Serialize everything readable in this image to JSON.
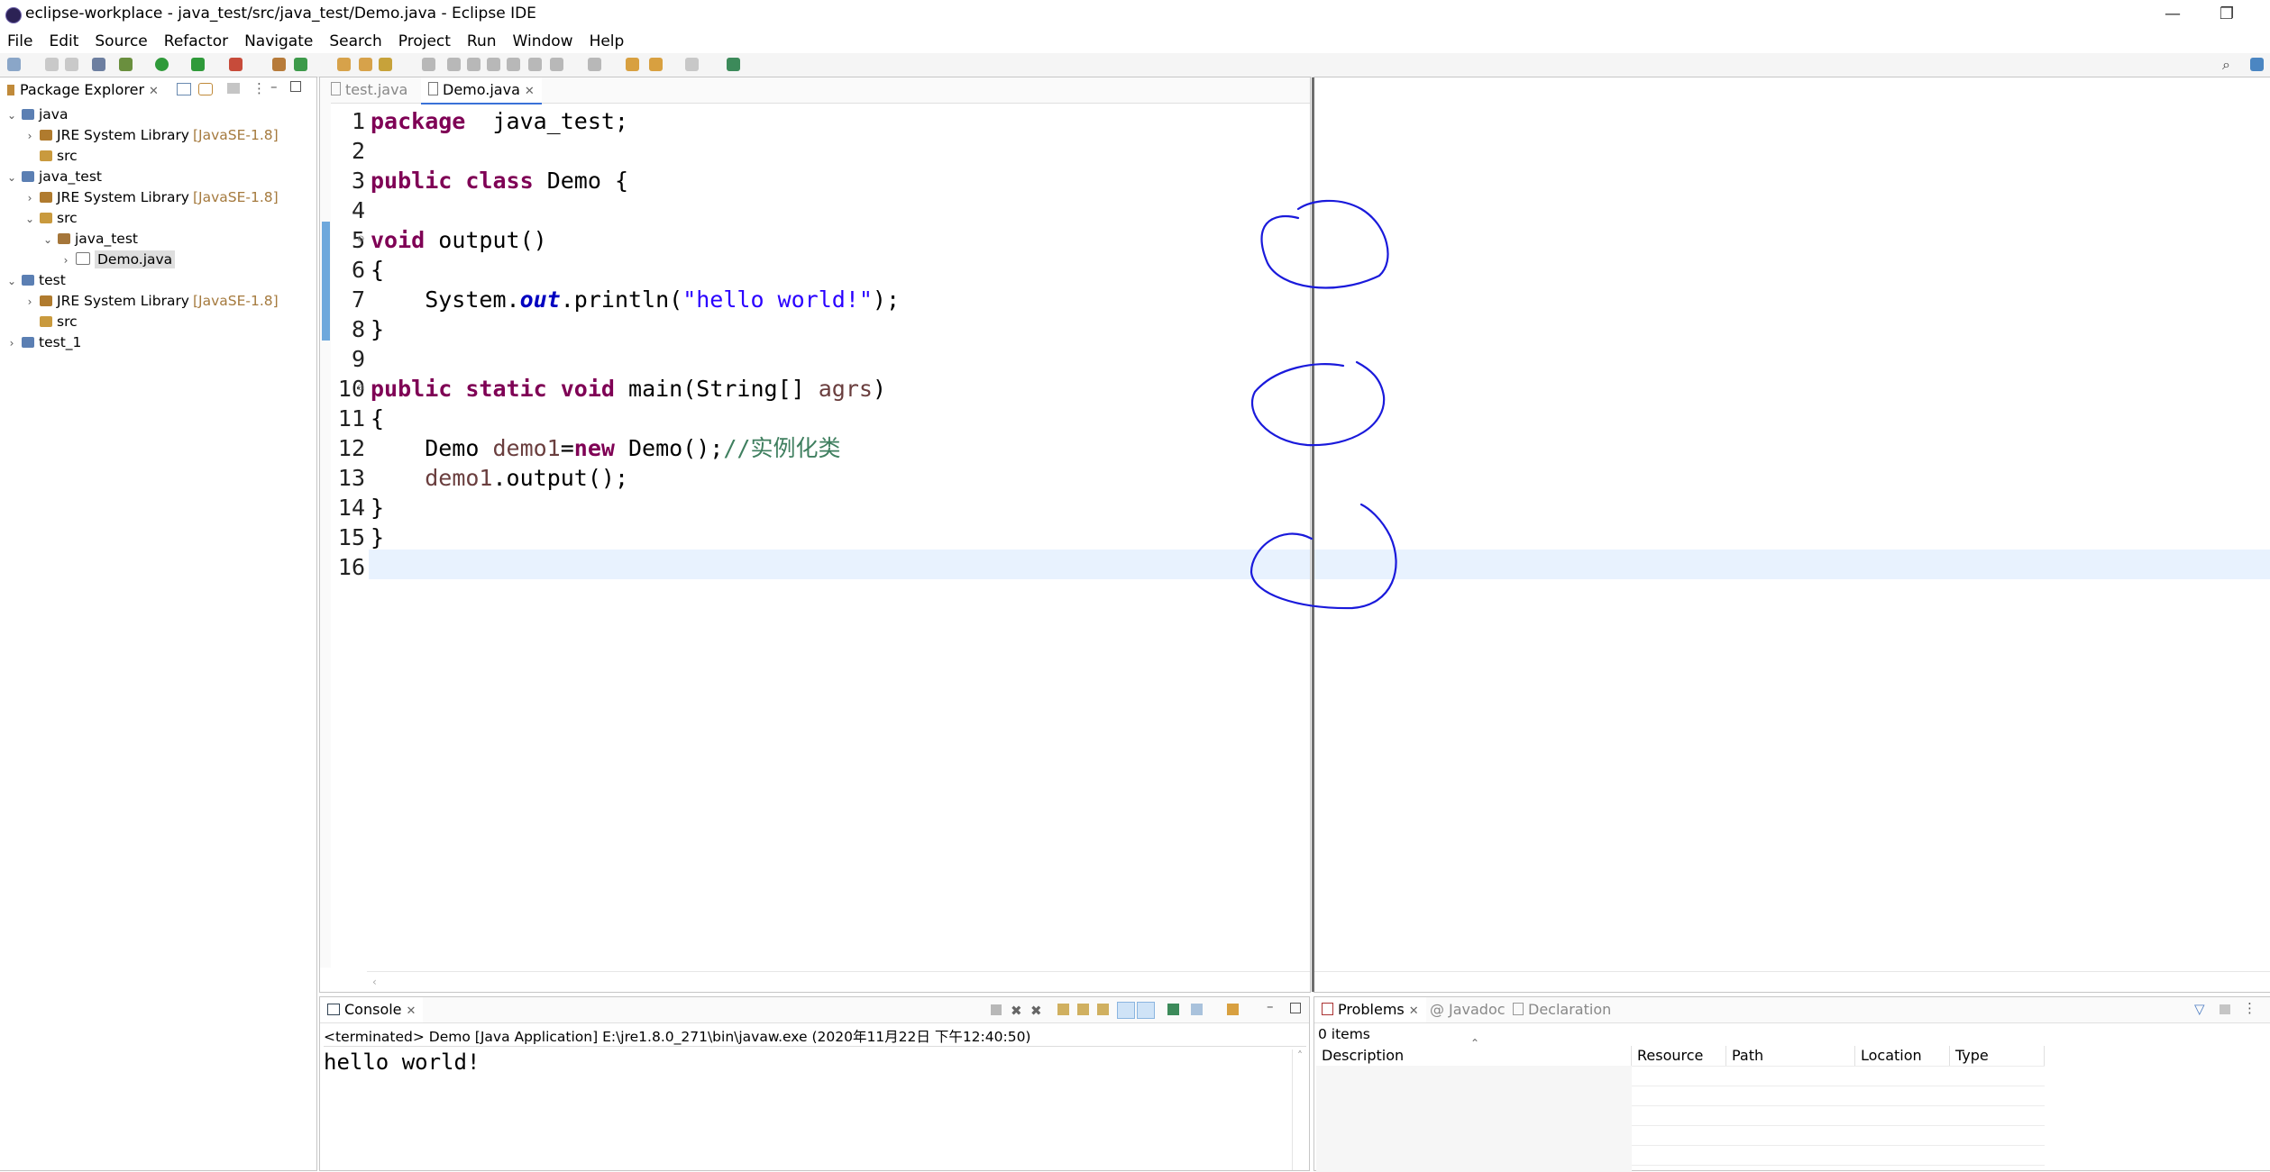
{
  "window": {
    "title": "eclipse-workplace - java_test/src/java_test/Demo.java - Eclipse IDE",
    "minimize_glyph": "—",
    "restore_glyph": "❐"
  },
  "menu": [
    "File",
    "Edit",
    "Source",
    "Refactor",
    "Navigate",
    "Search",
    "Project",
    "Run",
    "Window",
    "Help"
  ],
  "package_explorer": {
    "tab_label": "Package Explorer",
    "tree": [
      {
        "indent": 0,
        "arrow": "⌄",
        "icon": "project",
        "label": "java",
        "decoration": ""
      },
      {
        "indent": 1,
        "arrow": "›",
        "icon": "library",
        "label": "JRE System Library",
        "decoration": "[JavaSE-1.8]"
      },
      {
        "indent": 1,
        "arrow": "",
        "icon": "src",
        "label": "src",
        "decoration": ""
      },
      {
        "indent": 0,
        "arrow": "⌄",
        "icon": "project",
        "label": "java_test",
        "decoration": ""
      },
      {
        "indent": 1,
        "arrow": "›",
        "icon": "library",
        "label": "JRE System Library",
        "decoration": "[JavaSE-1.8]"
      },
      {
        "indent": 1,
        "arrow": "⌄",
        "icon": "src",
        "label": "src",
        "decoration": ""
      },
      {
        "indent": 2,
        "arrow": "⌄",
        "icon": "package",
        "label": "java_test",
        "decoration": ""
      },
      {
        "indent": 3,
        "arrow": "›",
        "icon": "java-file",
        "label": "Demo.java",
        "decoration": "",
        "selected": true
      },
      {
        "indent": 0,
        "arrow": "⌄",
        "icon": "project",
        "label": "test",
        "decoration": ""
      },
      {
        "indent": 1,
        "arrow": "›",
        "icon": "library",
        "label": "JRE System Library",
        "decoration": "[JavaSE-1.8]"
      },
      {
        "indent": 1,
        "arrow": "",
        "icon": "src",
        "label": "src",
        "decoration": ""
      },
      {
        "indent": 0,
        "arrow": "›",
        "icon": "project",
        "label": "test_1",
        "decoration": ""
      }
    ]
  },
  "editor": {
    "tabs": [
      {
        "label": "test.java",
        "active": false
      },
      {
        "label": "Demo.java",
        "active": true
      }
    ],
    "fold_marker_lines": [
      5,
      10
    ],
    "current_line": 16,
    "lines": [
      {
        "n": "1",
        "tokens": [
          [
            "kw",
            "package"
          ],
          [
            "",
            "  java_test;"
          ]
        ]
      },
      {
        "n": "2",
        "tokens": []
      },
      {
        "n": "3",
        "tokens": [
          [
            "kw",
            "public"
          ],
          [
            "",
            " "
          ],
          [
            "kw",
            "class"
          ],
          [
            "",
            " Demo {"
          ]
        ]
      },
      {
        "n": "4",
        "tokens": []
      },
      {
        "n": "5",
        "tokens": [
          [
            "kw",
            "void"
          ],
          [
            "",
            " output()"
          ]
        ]
      },
      {
        "n": "6",
        "tokens": [
          [
            "",
            "{"
          ]
        ]
      },
      {
        "n": "7",
        "tokens": [
          [
            "",
            "    System."
          ],
          [
            "fld",
            "out"
          ],
          [
            "",
            ".println("
          ],
          [
            "str",
            "\"hello world!\""
          ],
          [
            "",
            ");"
          ]
        ]
      },
      {
        "n": "8",
        "tokens": [
          [
            "",
            "}"
          ]
        ]
      },
      {
        "n": "9",
        "tokens": []
      },
      {
        "n": "10",
        "tokens": [
          [
            "kw",
            "public"
          ],
          [
            "",
            " "
          ],
          [
            "kw",
            "static"
          ],
          [
            "",
            " "
          ],
          [
            "kw",
            "void"
          ],
          [
            "",
            " main(String[] "
          ],
          [
            "var",
            "agrs"
          ],
          [
            "",
            ")"
          ]
        ]
      },
      {
        "n": "11",
        "tokens": [
          [
            "",
            "{"
          ]
        ]
      },
      {
        "n": "12",
        "tokens": [
          [
            "",
            "    Demo "
          ],
          [
            "var",
            "demo1"
          ],
          [
            "",
            "="
          ],
          [
            "kw",
            "new"
          ],
          [
            "",
            " Demo();"
          ],
          [
            "cmt",
            "//实例化类"
          ]
        ]
      },
      {
        "n": "13",
        "tokens": [
          [
            "",
            "    "
          ],
          [
            "var",
            "demo1"
          ],
          [
            "",
            ".output();"
          ]
        ]
      },
      {
        "n": "14",
        "tokens": [
          [
            "",
            "}"
          ]
        ]
      },
      {
        "n": "15",
        "tokens": [
          [
            "",
            "}"
          ]
        ]
      },
      {
        "n": "16",
        "tokens": []
      }
    ]
  },
  "console": {
    "tab_label": "Console",
    "status": "<terminated> Demo [Java Application] E:\\jre1.8.0_271\\bin\\javaw.exe  (2020年11月22日 下午12:40:50)",
    "output": "hello world!"
  },
  "problems": {
    "tabs": [
      {
        "label": "Problems",
        "active": true
      },
      {
        "label": "Javadoc",
        "active": false
      },
      {
        "label": "Declaration",
        "active": false
      }
    ],
    "count": "0 items",
    "columns": [
      "Description",
      "Resource",
      "Path",
      "Location",
      "Type"
    ]
  },
  "colors": {
    "annotation_ink": "#1a1adb",
    "selection_bar": "#6ea8dc",
    "current_line": "#e8f2fe"
  }
}
